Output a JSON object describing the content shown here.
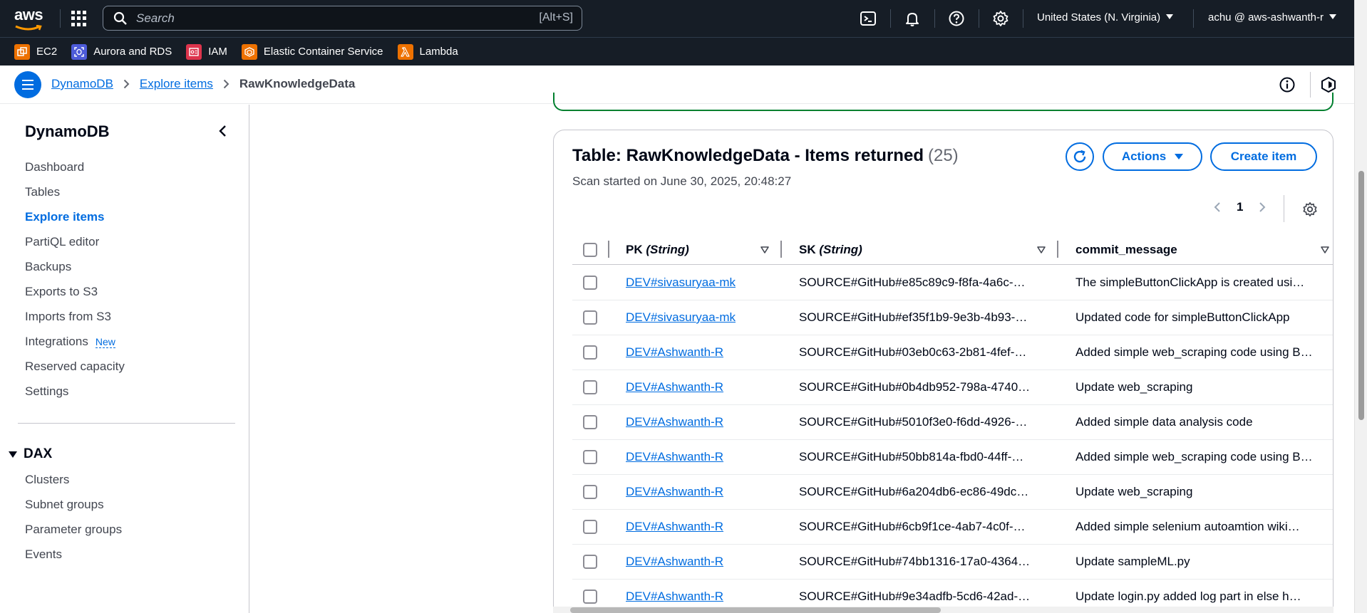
{
  "topbar": {
    "logo_text": "aws",
    "search_placeholder": "Search",
    "search_shortcut": "[Alt+S]",
    "region": "United States (N. Virginia)",
    "account": "achu @ aws-ashwanth-r"
  },
  "favorites": [
    {
      "label": "EC2",
      "icon": "ec2-icon",
      "color": "#ed7100"
    },
    {
      "label": "Aurora and RDS",
      "icon": "rds-icon",
      "color": "#4d5bd9"
    },
    {
      "label": "IAM",
      "icon": "iam-icon",
      "color": "#dd344c"
    },
    {
      "label": "Elastic Container Service",
      "icon": "ecs-icon",
      "color": "#ed7100"
    },
    {
      "label": "Lambda",
      "icon": "lambda-icon",
      "color": "#ed7100"
    }
  ],
  "breadcrumbs": {
    "items": [
      "DynamoDB",
      "Explore items"
    ],
    "current": "RawKnowledgeData"
  },
  "sidenav": {
    "title": "DynamoDB",
    "items": [
      "Dashboard",
      "Tables",
      "Explore items",
      "PartiQL editor",
      "Backups",
      "Exports to S3",
      "Imports from S3",
      "Integrations",
      "Reserved capacity",
      "Settings"
    ],
    "active": "Explore items",
    "new_badge": "New",
    "section": "DAX",
    "section_items": [
      "Clusters",
      "Subnet groups",
      "Parameter groups",
      "Events"
    ]
  },
  "panel": {
    "title": "Table: RawKnowledgeData - Items returned",
    "count": "(25)",
    "subtitle": "Scan started on June 30, 2025, 20:48:27",
    "actions_label": "Actions",
    "create_label": "Create item",
    "page_number": "1"
  },
  "table": {
    "columns": [
      {
        "name": "PK",
        "type": "(String)"
      },
      {
        "name": "SK",
        "type": "(String)"
      },
      {
        "name": "commit_message",
        "type": ""
      }
    ],
    "rows": [
      {
        "pk": "DEV#sivasuryaa-mk",
        "sk": "SOURCE#GitHub#e85c89c9-f8fa-4a6c-…",
        "msg": "The simpleButtonClickApp is created usi…"
      },
      {
        "pk": "DEV#sivasuryaa-mk",
        "sk": "SOURCE#GitHub#ef35f1b9-9e3b-4b93-…",
        "msg": "Updated code for simpleButtonClickApp"
      },
      {
        "pk": "DEV#Ashwanth-R",
        "sk": "SOURCE#GitHub#03eb0c63-2b81-4fef-…",
        "msg": "Added simple web_scraping code using B…"
      },
      {
        "pk": "DEV#Ashwanth-R",
        "sk": "SOURCE#GitHub#0b4db952-798a-4740…",
        "msg": "Update web_scraping"
      },
      {
        "pk": "DEV#Ashwanth-R",
        "sk": "SOURCE#GitHub#5010f3e0-f6dd-4926-…",
        "msg": "Added simple data analysis code"
      },
      {
        "pk": "DEV#Ashwanth-R",
        "sk": "SOURCE#GitHub#50bb814a-fbd0-44ff-…",
        "msg": "Added simple web_scraping code using B…"
      },
      {
        "pk": "DEV#Ashwanth-R",
        "sk": "SOURCE#GitHub#6a204db6-ec86-49dc…",
        "msg": "Update web_scraping"
      },
      {
        "pk": "DEV#Ashwanth-R",
        "sk": "SOURCE#GitHub#6cb9f1ce-4ab7-4c0f-…",
        "msg": "Added simple selenium autoamtion wiki…"
      },
      {
        "pk": "DEV#Ashwanth-R",
        "sk": "SOURCE#GitHub#74bb1316-17a0-4364…",
        "msg": "Update sampleML.py"
      },
      {
        "pk": "DEV#Ashwanth-R",
        "sk": "SOURCE#GitHub#9e34adfb-5cd6-42ad-…",
        "msg": "Update login.py added log part in else h…"
      }
    ]
  },
  "colors": {
    "primary": "#006ce0",
    "nav_bg": "#161d26",
    "success": "#00802f"
  }
}
